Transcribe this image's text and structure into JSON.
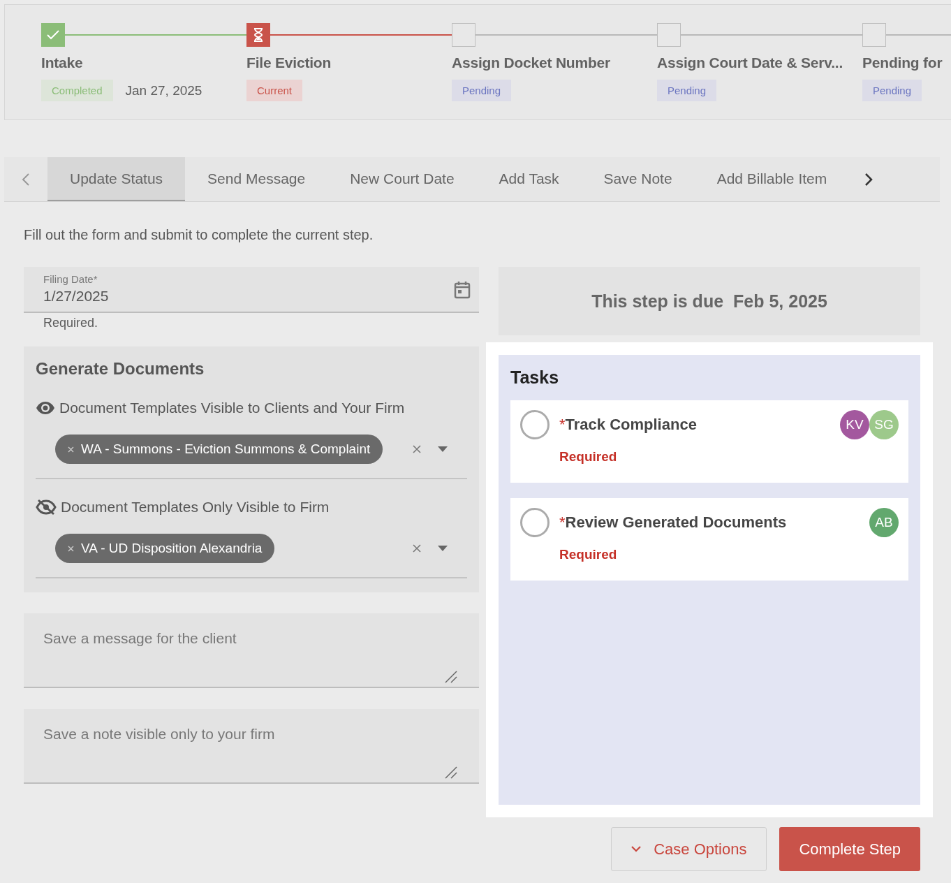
{
  "stepper": {
    "steps": [
      {
        "title": "Intake",
        "kind": "completed",
        "badge": "Completed",
        "date": "Jan 27, 2025"
      },
      {
        "title": "File Eviction",
        "kind": "current",
        "badge": "Current"
      },
      {
        "title": "Assign Docket Number",
        "kind": "pending",
        "badge": "Pending"
      },
      {
        "title": "Assign Court Date & Serv...",
        "kind": "pending",
        "badge": "Pending"
      },
      {
        "title": "Pending for",
        "kind": "pending",
        "badge": "Pending"
      }
    ]
  },
  "tabs": [
    {
      "label": "Update Status",
      "selected": true
    },
    {
      "label": "Send Message",
      "selected": false
    },
    {
      "label": "New Court Date",
      "selected": false
    },
    {
      "label": "Add Task",
      "selected": false
    },
    {
      "label": "Save Note",
      "selected": false
    },
    {
      "label": "Add Billable Item",
      "selected": false
    }
  ],
  "instructions": "Fill out the form and submit to complete the current step.",
  "filing_date": {
    "label": "Filing Date*",
    "value": "1/27/2025",
    "helper": "Required."
  },
  "due": {
    "label": "This step is due",
    "date": "Feb 5, 2025"
  },
  "documents": {
    "title": "Generate Documents",
    "groups": [
      {
        "kind": "visible",
        "label": "Document Templates Visible to Clients and Your Firm",
        "chips": [
          "WA - Summons - Eviction Summons & Complaint"
        ]
      },
      {
        "kind": "hidden",
        "label": "Document Templates Only Visible to Firm",
        "chips": [
          "VA - UD Disposition Alexandria"
        ]
      }
    ]
  },
  "message_field": {
    "placeholder": "Save a message for the client"
  },
  "note_field": {
    "placeholder": "Save a note visible only to your firm"
  },
  "tasks": {
    "title": "Tasks",
    "items": [
      {
        "mark": "*",
        "name": "Track Compliance",
        "status": "Required",
        "checked": false,
        "assignees": [
          {
            "initials": "KV",
            "color": "#a3589e"
          },
          {
            "initials": "SG",
            "color": "#9dc98b"
          }
        ]
      },
      {
        "mark": "*",
        "name": "Review Generated Documents",
        "status": "Required",
        "checked": false,
        "assignees": [
          {
            "initials": "AB",
            "color": "#62a86e"
          }
        ]
      }
    ]
  },
  "buttons": [
    {
      "kind": "secondary",
      "label": "Case Options"
    },
    {
      "kind": "primary",
      "label": "Complete Step"
    }
  ]
}
